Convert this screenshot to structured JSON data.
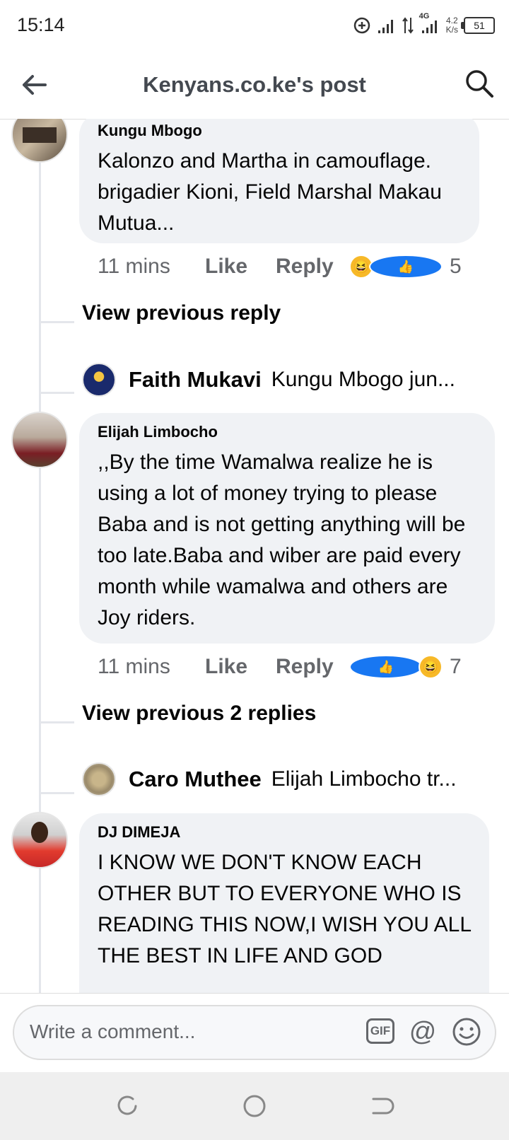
{
  "status_bar": {
    "time": "15:14",
    "net_speed": "4.2",
    "net_unit": "K/s",
    "battery": "51",
    "network_type": "4G"
  },
  "header": {
    "title": "Kenyans.co.ke's post"
  },
  "comments": [
    {
      "author": "Kungu Mbogo",
      "text": "Kalonzo and Martha in camouflage. brigadier Kioni, Field Marshal Makau Mutua...",
      "time": "11 mins",
      "like_label": "Like",
      "reply_label": "Reply",
      "reactions": [
        "haha",
        "like"
      ],
      "reaction_count": "5",
      "view_previous": "View previous reply",
      "latest_reply": {
        "author": "Faith Mukavi",
        "preview": "Kungu Mbogo jun..."
      }
    },
    {
      "author": "Elijah Limbocho",
      "text": ",,By the time Wamalwa realize he is using a lot of money trying to please Baba and is not getting anything will be too late.Baba and wiber are paid every month while wamalwa and others are Joy riders.",
      "time": "11 mins",
      "like_label": "Like",
      "reply_label": "Reply",
      "reactions": [
        "like",
        "haha"
      ],
      "reaction_count": "7",
      "view_previous": "View previous 2 replies",
      "latest_reply": {
        "author": "Caro Muthee",
        "preview": "Elijah Limbocho tr..."
      }
    },
    {
      "author": "DJ DIMEJA",
      "text": "I KNOW WE DON'T KNOW EACH OTHER BUT TO EVERYONE WHO IS READING THIS NOW,I WISH YOU ALL THE BEST IN LIFE AND GOD"
    }
  ],
  "composer": {
    "placeholder": "Write a comment...",
    "gif_label": "GIF"
  },
  "colors": {
    "bubble": "#f0f2f5",
    "like_blue": "#1877f2",
    "haha_yellow": "#f7b928",
    "secondary_text": "#65676b"
  }
}
